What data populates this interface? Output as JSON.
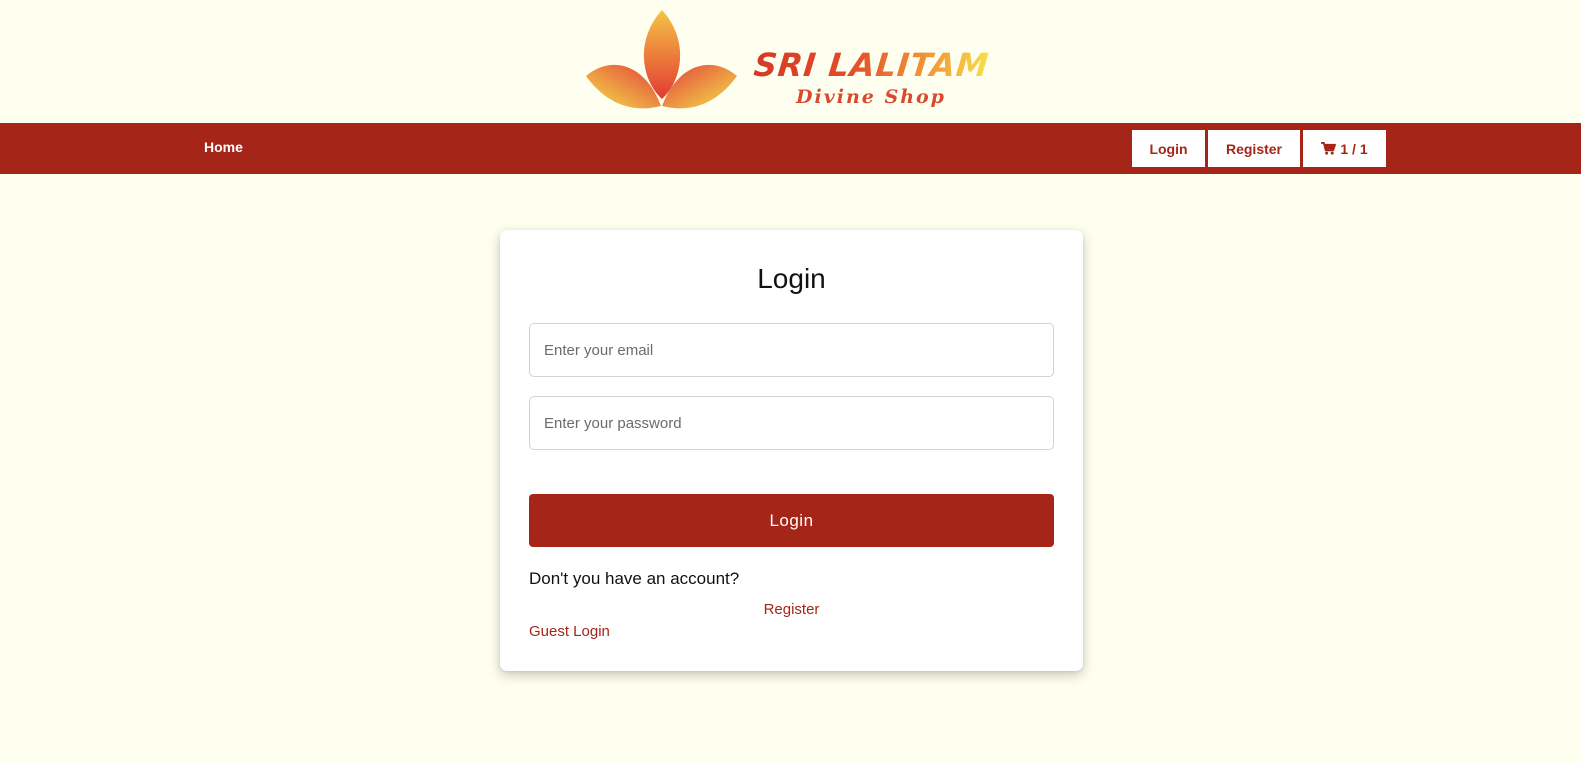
{
  "brand": {
    "name": "SRI LALITAM",
    "tagline": "Divine Shop",
    "colors": {
      "primary": "#a52619",
      "background": "#fffff0",
      "logo_gradient": [
        "#f7e04a",
        "#e8463a"
      ]
    }
  },
  "nav": {
    "home_label": "Home",
    "login_label": "Login",
    "register_label": "Register",
    "cart_icon": "shopping-cart-icon",
    "cart_label": "1 / 1"
  },
  "login_form": {
    "title": "Login",
    "email_placeholder": "Enter your email",
    "email_value": "",
    "password_placeholder": "Enter your password",
    "password_value": "",
    "submit_label": "Login",
    "prompt_text": "Don't you have an account?",
    "register_link_label": "Register",
    "guest_login_label": "Guest Login"
  }
}
